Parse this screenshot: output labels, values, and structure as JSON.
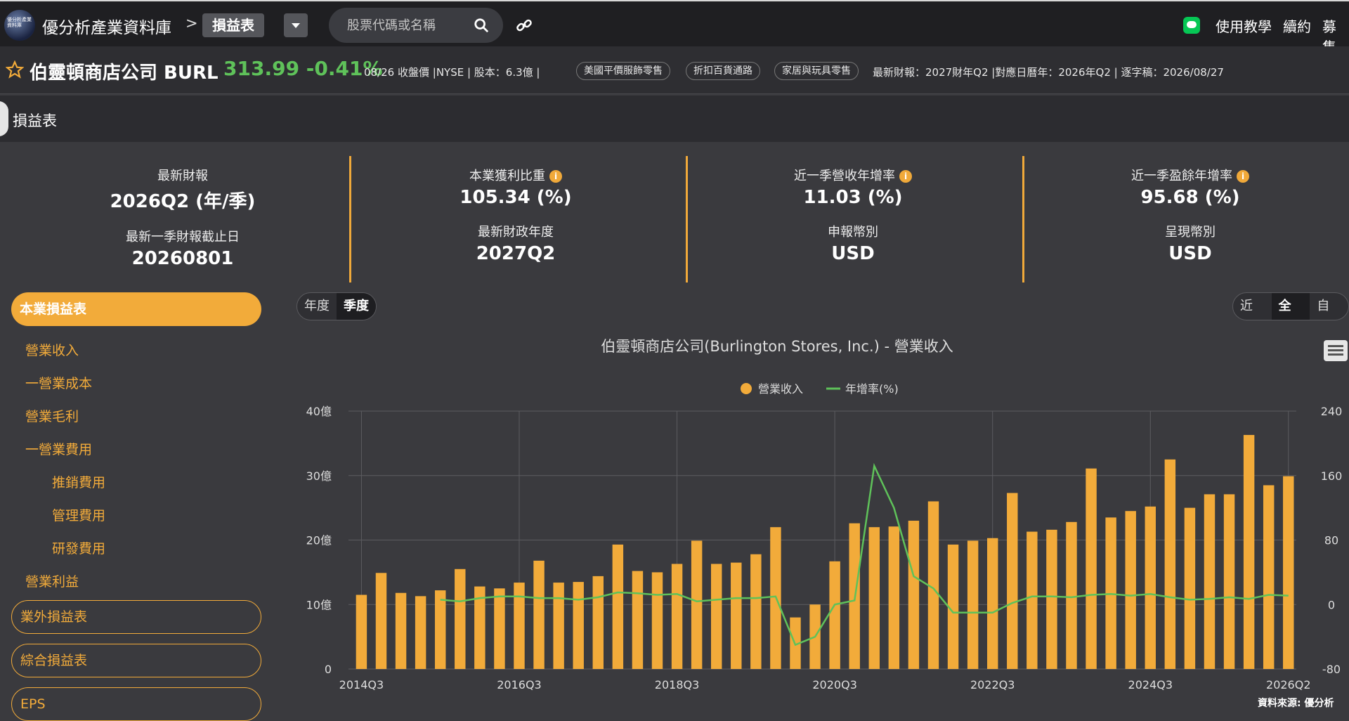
{
  "header": {
    "logo_text": "優分析產業資料庫",
    "brand": "優分析產業資料庫",
    "crumb_sep": ">",
    "crumb_current": "損益表",
    "search_placeholder": "股票代碼或名稱",
    "nav": [
      "使用教學",
      "續約",
      "募集"
    ]
  },
  "stock": {
    "name": "伯靈頓商店公司 BURL",
    "price_change": "313.99 -0.41%",
    "meta1": "08/26 收盤價 |NYSE | 股本：6.3億 |",
    "tags": [
      "美國平價服飾零售",
      "折扣百貨通路",
      "家居與玩具零售"
    ],
    "meta2": "最新財報：2027財年Q2 |對應日曆年：2026年Q2 | 逐字稿：2026/08/27"
  },
  "section_title": "損益表",
  "stats": [
    {
      "label1": "最新財報",
      "value1": "2026Q2 (年/季)",
      "label2": "最新一季財報截止日",
      "value2": "20260801",
      "info": false
    },
    {
      "label1": "本業獲利比重",
      "value1": "105.34 (%)",
      "label2": "最新財政年度",
      "value2": "2027Q2",
      "info": true
    },
    {
      "label1": "近一季營收年增率",
      "value1": "11.03 (%)",
      "label2": "申報幣別",
      "value2": "USD",
      "info": true
    },
    {
      "label1": "近一季盈餘年增率",
      "value1": "95.68 (%)",
      "label2": "呈現幣別",
      "value2": "USD",
      "info": true
    }
  ],
  "sidebar": {
    "active": "本業損益表",
    "items": [
      "營業收入",
      "一營業成本",
      "營業毛利",
      "一營業費用",
      "推銷費用",
      "管理費用",
      "研發費用",
      "營業利益"
    ],
    "pills": [
      "業外損益表",
      "綜合損益表",
      "EPS"
    ]
  },
  "period_toggle": [
    "年度",
    "季度"
  ],
  "range_toggle": [
    "近期",
    "全部",
    "自訂"
  ],
  "source": "資料來源: 優分析",
  "chart_data": {
    "type": "bar",
    "title": "伯靈頓商店公司(Burlington Stores, Inc.) - 營業收入",
    "legend": [
      "營業收入",
      "年增率(%)"
    ],
    "legend_position": "top-center",
    "y_left_ticks": [
      "0",
      "10億",
      "20億",
      "30億",
      "40億"
    ],
    "y_left_range": [
      0,
      40
    ],
    "y_right_ticks": [
      "-80",
      "0",
      "80",
      "160",
      "240"
    ],
    "y_right_range": [
      -80,
      240
    ],
    "x_tick_labels": [
      "2014Q3",
      "2016Q3",
      "2018Q3",
      "2020Q3",
      "2022Q3",
      "2024Q3",
      "2026Q2"
    ],
    "grid": true,
    "bar_color": "#f2ab3a",
    "line_color": "#5fc25a",
    "series": [
      {
        "name": "營業收入",
        "unit": "億",
        "values": [
          11.5,
          14.9,
          11.8,
          11.3,
          12.2,
          15.5,
          12.8,
          12.5,
          13.4,
          16.8,
          13.4,
          13.5,
          14.4,
          19.3,
          15.2,
          15.0,
          16.3,
          19.9,
          16.3,
          16.5,
          17.8,
          22.0,
          8.0,
          10.0,
          16.7,
          22.6,
          22.0,
          22.1,
          23.0,
          26.0,
          19.3,
          19.9,
          20.3,
          27.3,
          21.3,
          21.6,
          22.8,
          31.1,
          23.5,
          24.5,
          25.2,
          32.5,
          25.0,
          27.1,
          27.1,
          36.3,
          28.5,
          29.9
        ]
      },
      {
        "name": "年增率(%)",
        "values": [
          null,
          null,
          null,
          null,
          6,
          4,
          8,
          10,
          10,
          8,
          8,
          6,
          9,
          15,
          14,
          12,
          13,
          4,
          6,
          8,
          8,
          10,
          -50,
          -40,
          0,
          5,
          172,
          120,
          35,
          20,
          -10,
          -10,
          -10,
          2,
          10,
          10,
          9,
          12,
          13,
          11,
          13,
          9,
          6,
          7,
          9,
          7,
          12,
          11
        ]
      }
    ]
  }
}
